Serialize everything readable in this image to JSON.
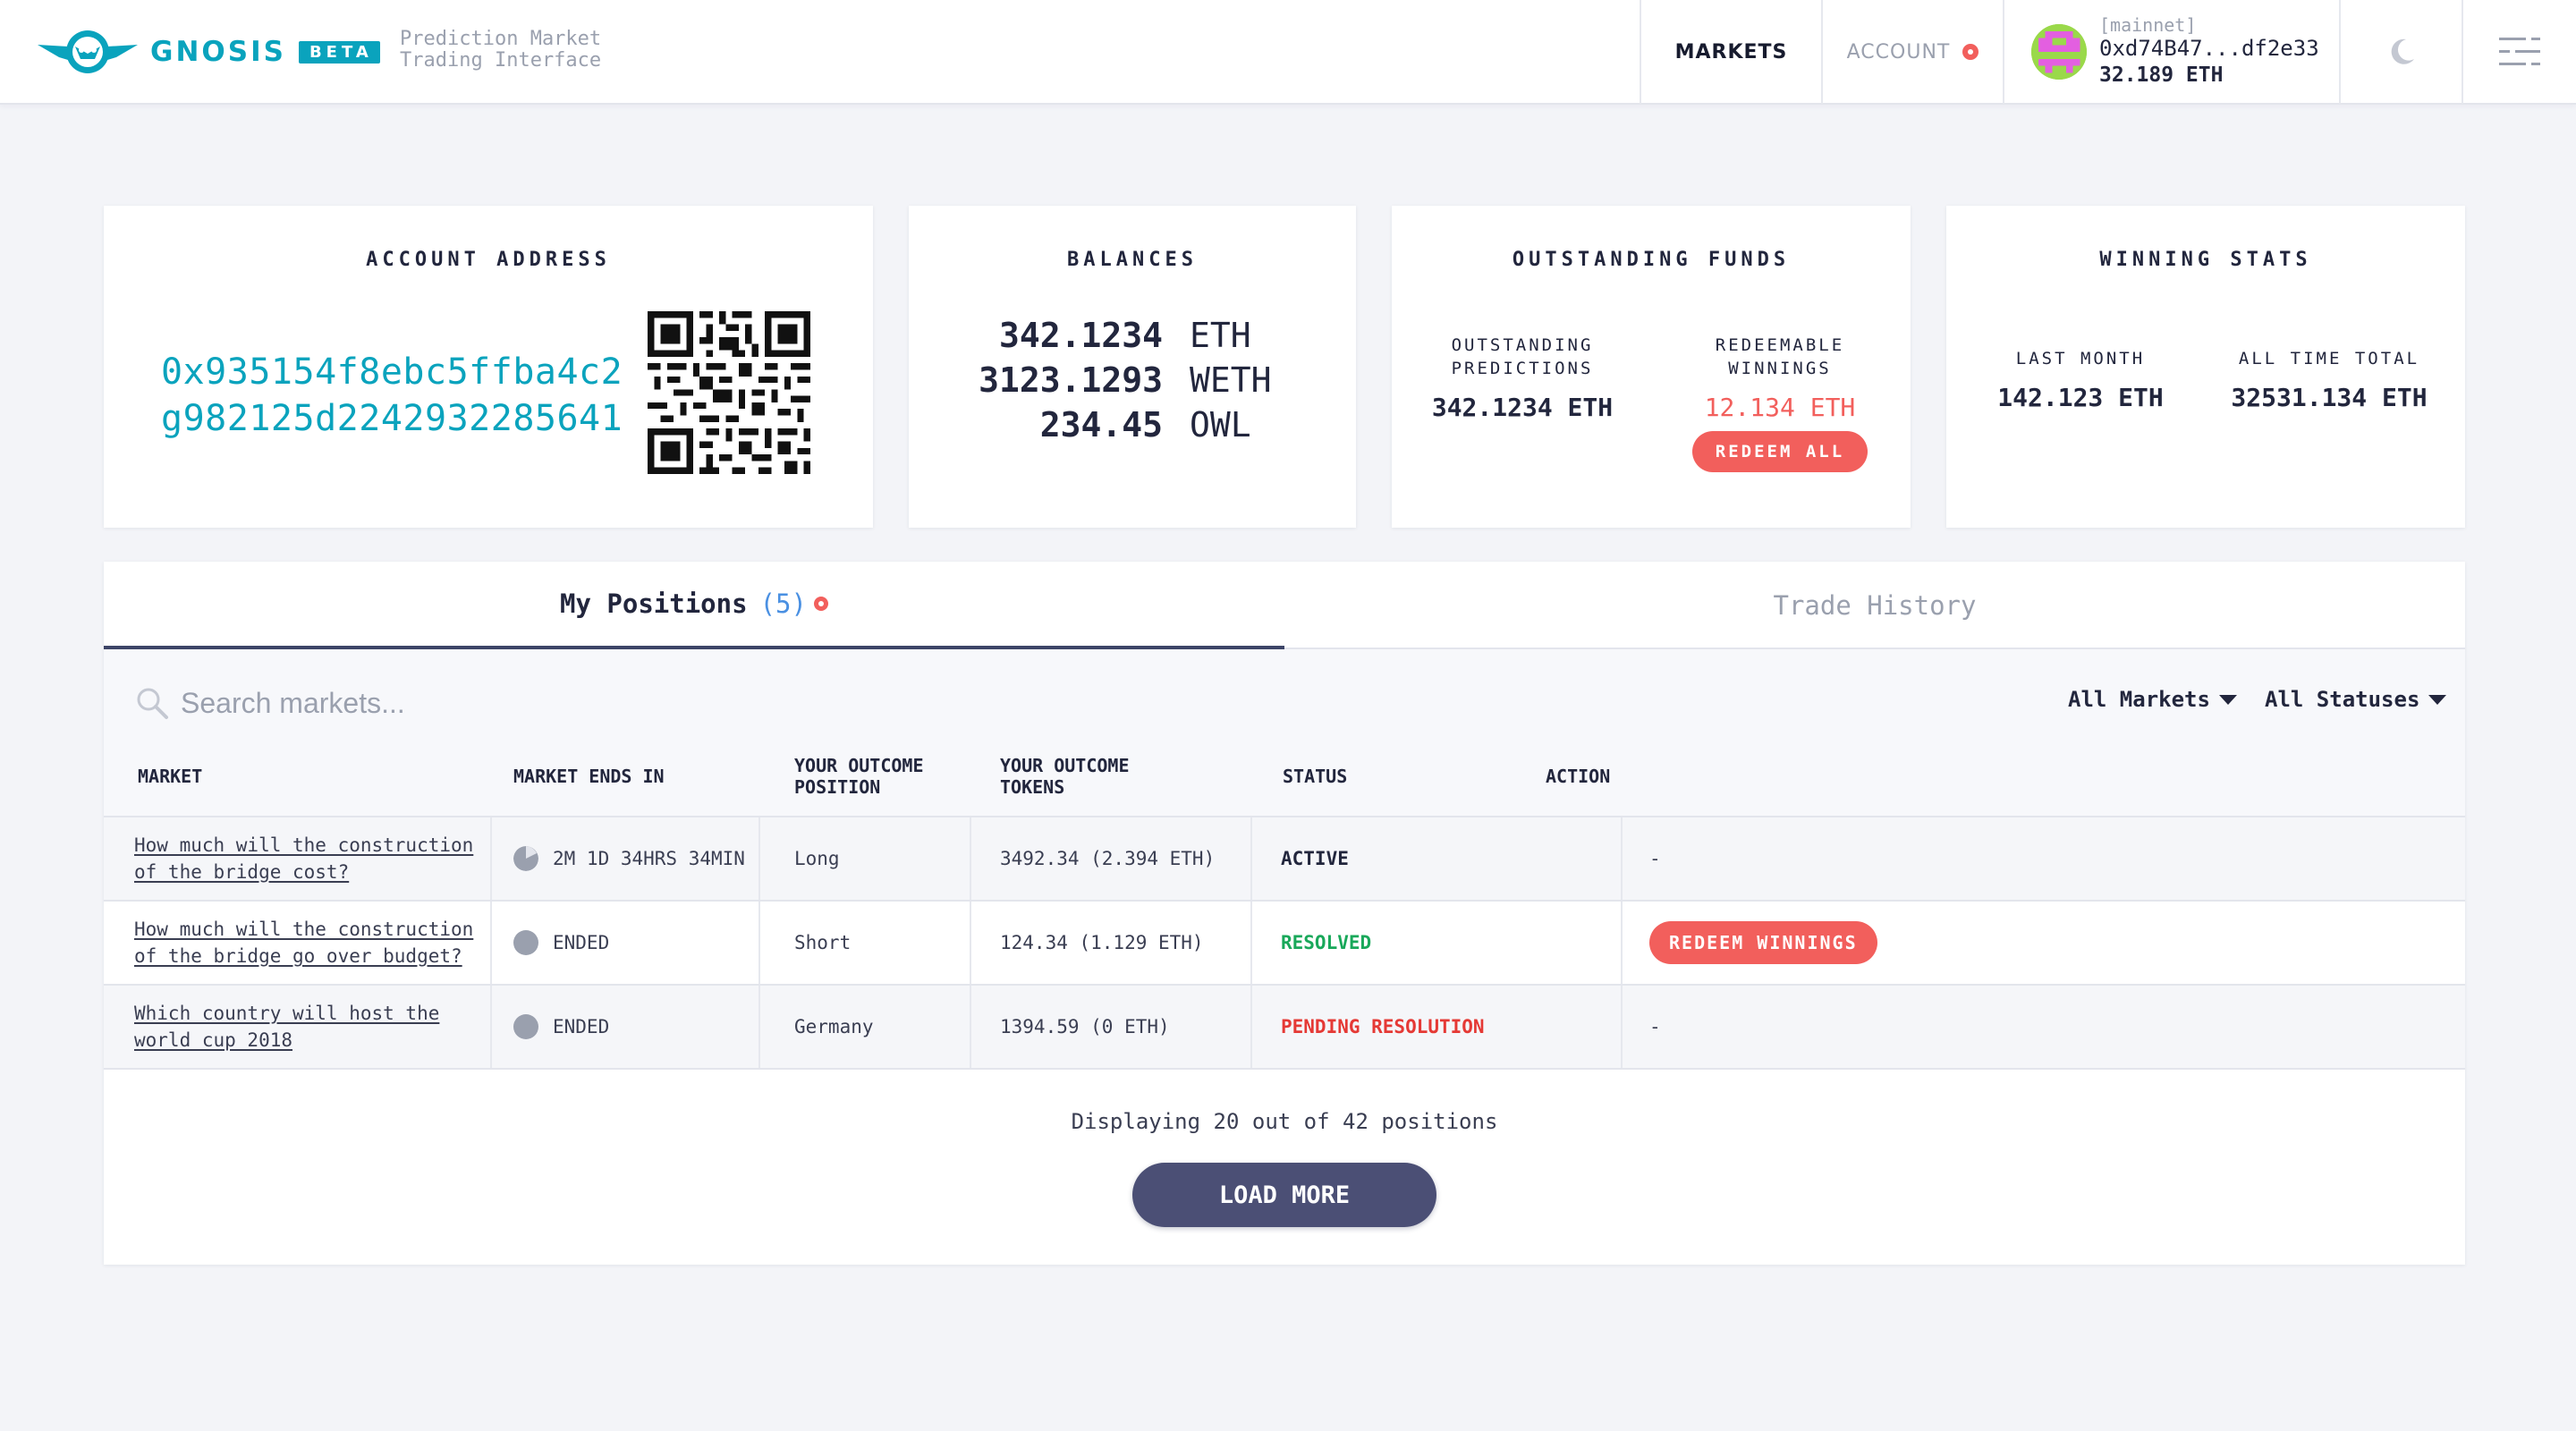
{
  "header": {
    "brand": "GNOSIS",
    "beta": "BETA",
    "tagline_line1": "Prediction Market",
    "tagline_line2": "Trading Interface",
    "nav_markets": "MARKETS",
    "nav_account": "ACCOUNT",
    "wallet": {
      "network": "[mainnet]",
      "address": "0xd74B47...df2e33",
      "balance": "32.189 ETH"
    },
    "icons": [
      "gnosis-owl-logo",
      "moon-icon",
      "menu-icon"
    ]
  },
  "account_card": {
    "title": "ACCOUNT ADDRESS",
    "address_line1": "0x935154f8ebc5ffba4c2",
    "address_line2": "g982125d2242932285641"
  },
  "balances_card": {
    "title": "BALANCES",
    "rows": [
      {
        "value": "342.1234",
        "currency": "ETH"
      },
      {
        "value": "3123.1293",
        "currency": "WETH"
      },
      {
        "value": "234.45",
        "currency": "OWL"
      }
    ]
  },
  "outstanding_card": {
    "title": "OUTSTANDING FUNDS",
    "predictions_label_1": "OUTSTANDING",
    "predictions_label_2": "PREDICTIONS",
    "predictions_value": "342.1234 ETH",
    "winnings_label_1": "REDEEMABLE",
    "winnings_label_2": "WINNINGS",
    "winnings_value": "12.134 ETH",
    "redeem_all": "REDEEM ALL"
  },
  "winning_card": {
    "title": "WINNING STATS",
    "last_month_label": "LAST MONTH",
    "last_month_value": "142.123 ETH",
    "all_time_label": "ALL TIME TOTAL",
    "all_time_value": "32531.134 ETH"
  },
  "positions": {
    "tab_positions": "My Positions",
    "tab_positions_count": "(5)",
    "tab_history": "Trade History",
    "search_placeholder": "Search markets...",
    "filter_markets": "All Markets",
    "filter_statuses": "All Statuses",
    "columns": {
      "market": "MARKET",
      "ends_in": "MARKET ENDS IN",
      "position_1": "YOUR OUTCOME",
      "position_2": "POSITION",
      "tokens_1": "YOUR OUTCOME",
      "tokens_2": "TOKENS",
      "status": "STATUS",
      "action": "ACTION"
    },
    "rows": [
      {
        "market_1": "How much will the construction",
        "market_2": "of the bridge cost?",
        "ends_in": "2M 1D 34HRS 34MIN",
        "position": "Long",
        "tokens": "3492.34 (2.394 ETH)",
        "status": "ACTIVE",
        "action": "-"
      },
      {
        "market_1": "How much will the construction",
        "market_2": "of the bridge go over budget?",
        "ends_in": "ENDED",
        "position": "Short",
        "tokens": "124.34 (1.129 ETH)",
        "status": "RESOLVED",
        "action": "REDEEM WINNINGS"
      },
      {
        "market_1": "Which country will host the",
        "market_2": "world cup 2018",
        "ends_in": "ENDED",
        "position": "Germany",
        "tokens": "1394.59 (0 ETH)",
        "status": "PENDING RESOLUTION",
        "action": "-"
      }
    ],
    "footer_text": "Displaying 20 out of 42 positions",
    "load_more": "LOAD MORE"
  },
  "colors": {
    "brand": "#0aa3bd",
    "accent_red": "#f25f5c",
    "resolved_green": "#19a85a",
    "pending_red": "#e53935",
    "load_more_bg": "#4b4f75"
  }
}
